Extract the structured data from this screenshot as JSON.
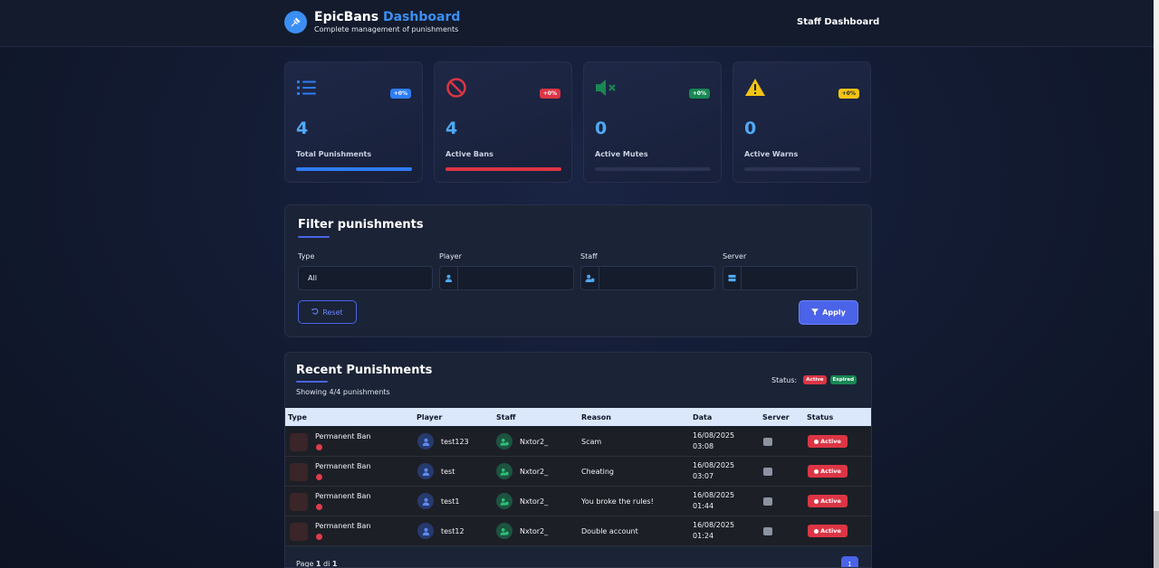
{
  "header": {
    "brand_name": "EpicBans",
    "brand_accent": "Dashboard",
    "subtitle": "Complete management of punishments",
    "nav_link": "Staff Dashboard"
  },
  "stats": [
    {
      "value": "4",
      "label": "Total Punishments",
      "badge": "+0%",
      "color": "#2f7cf5",
      "icon": "list-icon",
      "bar_fill": 1.0
    },
    {
      "value": "4",
      "label": "Active Bans",
      "badge": "+0%",
      "color": "#dc3545",
      "icon": "ban-icon",
      "bar_fill": 1.0
    },
    {
      "value": "0",
      "label": "Active Mutes",
      "badge": "+0%",
      "color": "#198754",
      "icon": "mute-icon",
      "bar_fill": 0.0
    },
    {
      "value": "0",
      "label": "Active Warns",
      "badge": "+0%",
      "color": "#f2c413",
      "icon": "warning-icon",
      "bar_fill": 0.0
    }
  ],
  "filter": {
    "title": "Filter punishments",
    "type_label": "Type",
    "type_value": "All",
    "player_label": "Player",
    "staff_label": "Staff",
    "server_label": "Server",
    "reset_label": "Reset",
    "apply_label": "Apply"
  },
  "table": {
    "title": "Recent Punishments",
    "showing": "Showing 4/4 punishments",
    "status_label": "Status:",
    "legend_active": "Active",
    "legend_expired": "Expired",
    "columns": [
      "Type",
      "Player",
      "Staff",
      "Reason",
      "Data",
      "Server",
      "Status"
    ],
    "rows": [
      {
        "type": "Permanent Ban",
        "player": "test123",
        "staff": "Nxtor2_",
        "reason": "Scam",
        "date": "16/08/2025",
        "time": "03:08",
        "status": "Active"
      },
      {
        "type": "Permanent Ban",
        "player": "test",
        "staff": "Nxtor2_",
        "reason": "Cheating",
        "date": "16/08/2025",
        "time": "03:07",
        "status": "Active"
      },
      {
        "type": "Permanent Ban",
        "player": "test1",
        "staff": "Nxtor2_",
        "reason": "You broke the rules!",
        "date": "16/08/2025",
        "time": "01:44",
        "status": "Active"
      },
      {
        "type": "Permanent Ban",
        "player": "test12",
        "staff": "Nxtor2_",
        "reason": "Double account",
        "date": "16/08/2025",
        "time": "01:24",
        "status": "Active"
      }
    ],
    "pager_prefix": "Page",
    "pager_current": "1",
    "pager_of": "di",
    "pager_total": "1",
    "pager_button": "1"
  },
  "colors": {
    "accent": "#4a63e8",
    "brand_blue": "#3b8ff3",
    "danger": "#dc3545",
    "success": "#198754"
  }
}
